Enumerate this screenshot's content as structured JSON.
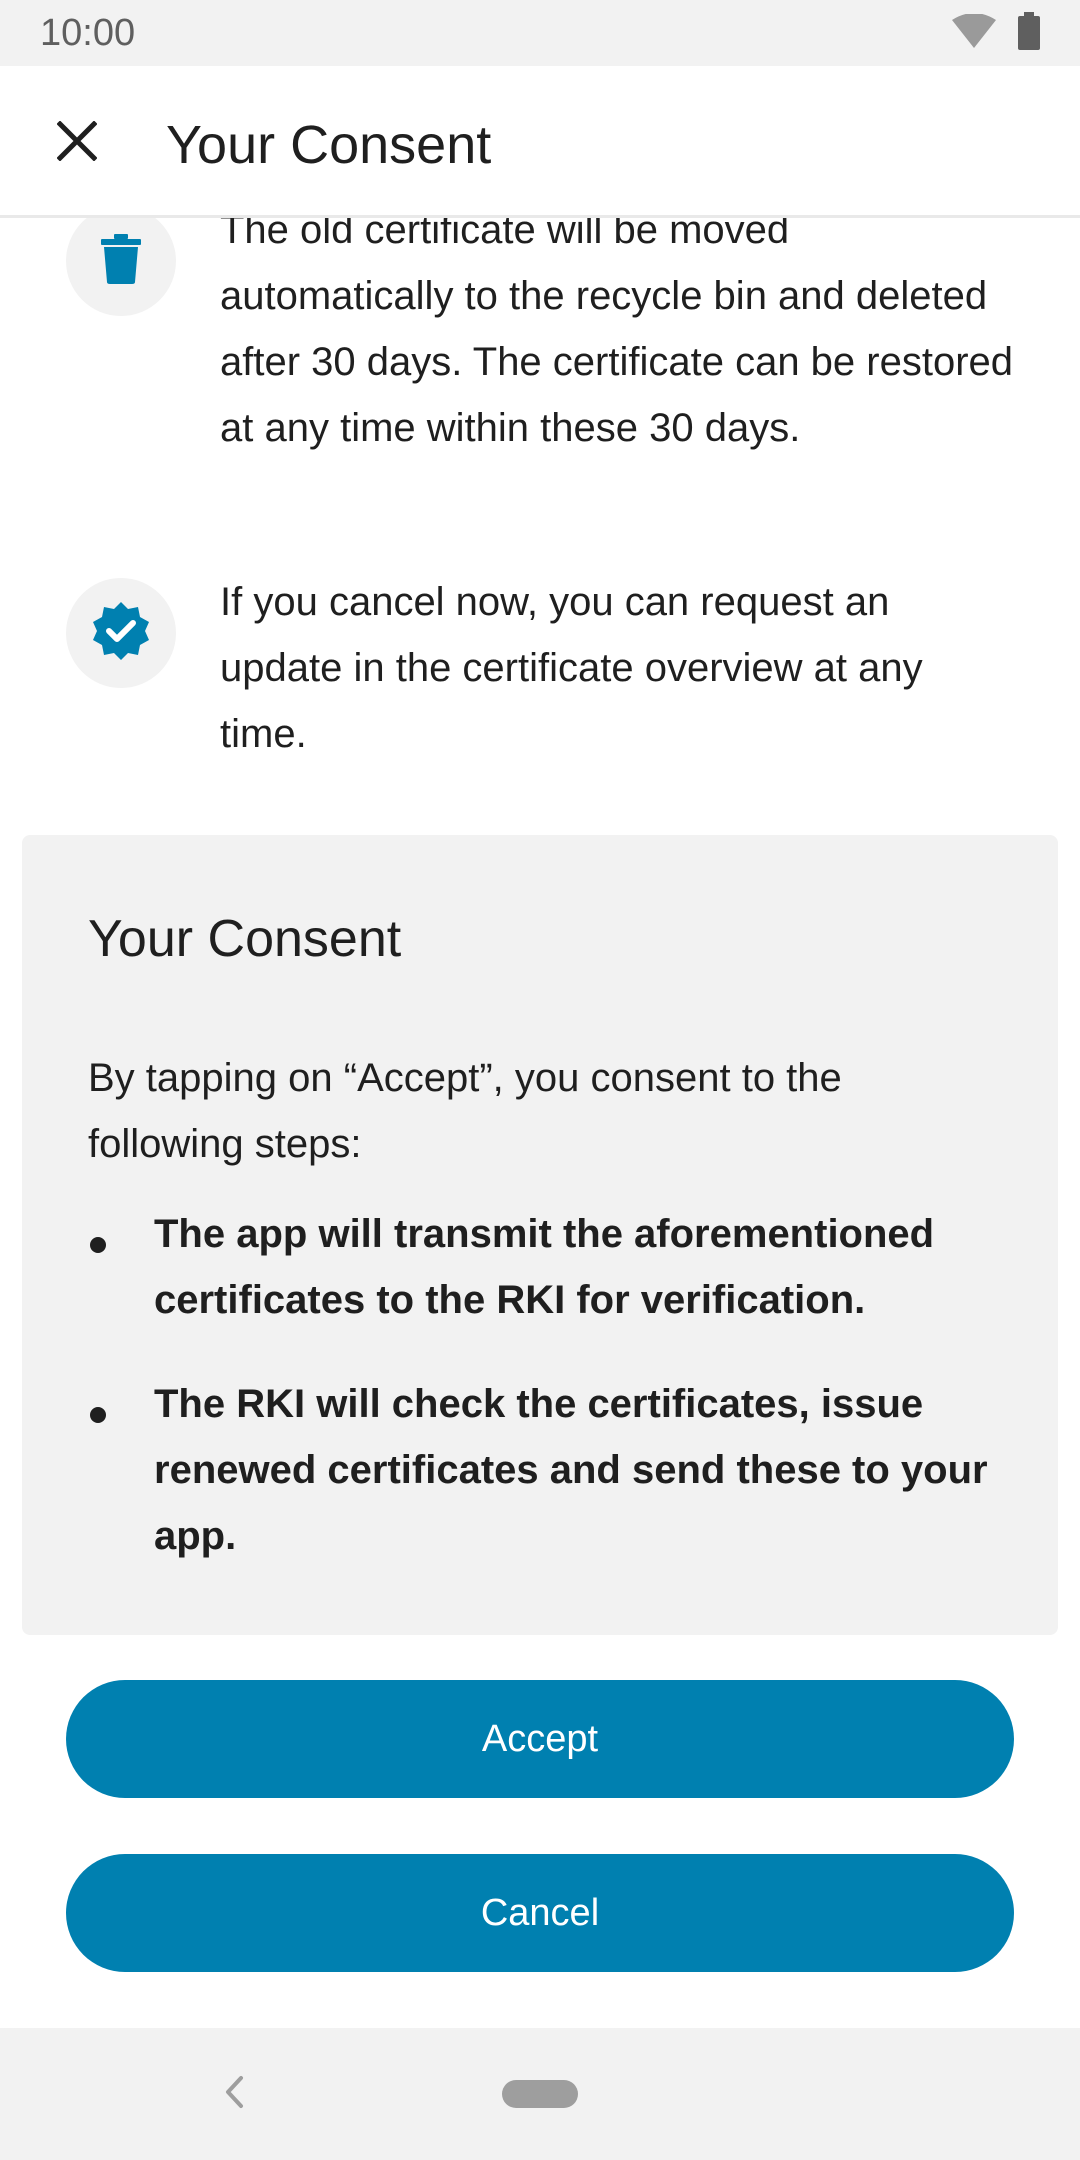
{
  "status_bar": {
    "time": "10:00",
    "icons": [
      "wifi-icon",
      "battery-icon"
    ]
  },
  "app_bar": {
    "title": "Your Consent",
    "close_icon": "close-icon"
  },
  "info_items": [
    {
      "icon": "trash-icon",
      "text": "The old certificate will be moved automatically to the recycle bin and deleted after 30 days. The certificate can be restored at any time within these 30 days."
    },
    {
      "icon": "verified-badge-icon",
      "text": "If you cancel now, you can request an update in the certificate overview at any time."
    }
  ],
  "consent": {
    "title": "Your Consent",
    "intro": "By tapping on “Accept”, you consent to the following steps:",
    "bullets": [
      "The app will transmit the aforementioned certificates to the RKI for verification.",
      "The RKI will check the certificates, issue renewed certificates and send these to your app."
    ]
  },
  "buttons": {
    "accept": "Accept",
    "cancel": "Cancel"
  },
  "colors": {
    "accent": "#0080b0",
    "surface": "#f2f2f2",
    "text": "#1f1f1f"
  }
}
